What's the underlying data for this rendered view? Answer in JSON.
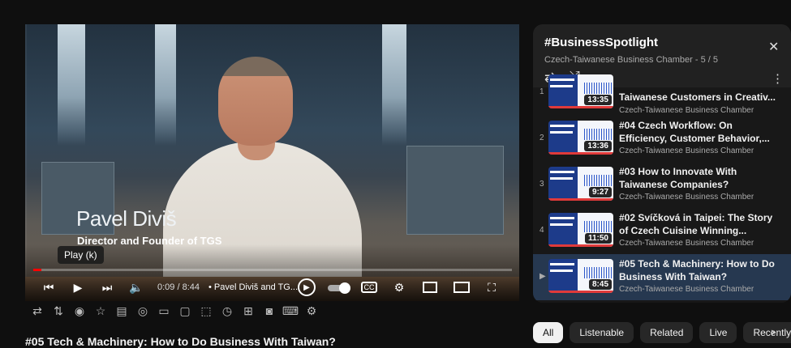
{
  "player": {
    "overlay_name": "Pavel Diviš",
    "overlay_role": "Director and Founder of TGS",
    "tooltip": "Play (k)",
    "time": "0:09 / 8:44",
    "chapter": "• Pavel Diviš and TG...",
    "progress_fraction": 0.017,
    "icons": [
      "previous-icon",
      "play-icon",
      "next-icon",
      "volume-icon",
      "autoplay-toggle",
      "captions-icon",
      "settings-icon",
      "miniplayer-icon",
      "theater-icon",
      "fullscreen-icon"
    ],
    "accent_color": "#ff0000"
  },
  "toolbar": {
    "icons": [
      "loop-icon",
      "sort-icon",
      "broadcast-icon",
      "star-icon",
      "screenshot-hd-icon",
      "eye-caption-icon",
      "frame-icon",
      "layout-icon",
      "dotted-frame-icon",
      "speed-icon",
      "add-frame-icon",
      "camera-icon",
      "keyboard-icon",
      "gear-icon"
    ]
  },
  "video": {
    "title": "#05 Tech & Machinery: How to Do Business With Taiwan?"
  },
  "playlist": {
    "title": "#BusinessSpotlight",
    "subtitle": "Czech-Taiwanese Business Chamber - 5 / 5",
    "items": [
      {
        "num": "1",
        "title": "Taiwanese Customers in Creativ...",
        "channel": "Czech-Taiwanese Business Chamber",
        "duration": "13:35",
        "active": false
      },
      {
        "num": "2",
        "title": "#04 Czech Workflow: On Efficiency, Customer Behavior,...",
        "channel": "Czech-Taiwanese Business Chamber",
        "duration": "13:36",
        "active": false
      },
      {
        "num": "3",
        "title": "#03 How to Innovate With Taiwanese Companies?",
        "channel": "Czech-Taiwanese Business Chamber",
        "duration": "9:27",
        "active": false
      },
      {
        "num": "4",
        "title": "#02 Svíčková in Taipei: The Story of Czech Cuisine Winning...",
        "channel": "Czech-Taiwanese Business Chamber",
        "duration": "11:50",
        "active": false
      },
      {
        "num": "▶",
        "title": "#05 Tech & Machinery: How to Do Business With Taiwan?",
        "channel": "Czech-Taiwanese Business Chamber",
        "duration": "8:45",
        "active": true
      }
    ]
  },
  "chips": [
    "All",
    "Listenable",
    "Related",
    "Live",
    "Recently"
  ]
}
